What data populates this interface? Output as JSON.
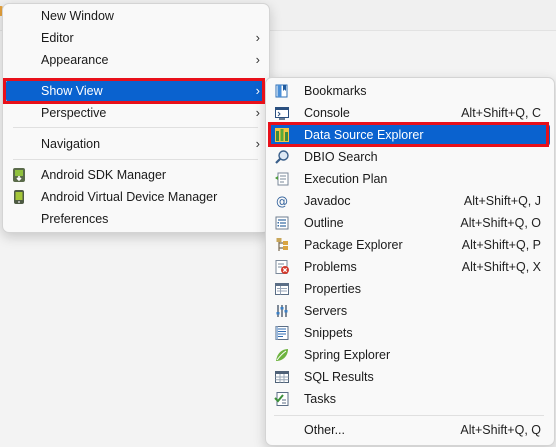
{
  "menu": {
    "items": [
      {
        "label": "New Window"
      },
      {
        "label": "Editor"
      },
      {
        "label": "Appearance"
      },
      {
        "label": "Show View"
      },
      {
        "label": "Perspective"
      },
      {
        "label": "Navigation"
      },
      {
        "label": "Android SDK Manager"
      },
      {
        "label": "Android Virtual Device Manager"
      },
      {
        "label": "Preferences"
      }
    ]
  },
  "submenu": {
    "items": [
      {
        "label": "Bookmarks",
        "shortcut": ""
      },
      {
        "label": "Console",
        "shortcut": "Alt+Shift+Q, C"
      },
      {
        "label": "Data Source Explorer",
        "shortcut": ""
      },
      {
        "label": "DBIO Search",
        "shortcut": ""
      },
      {
        "label": "Execution Plan",
        "shortcut": ""
      },
      {
        "label": "Javadoc",
        "shortcut": "Alt+Shift+Q, J"
      },
      {
        "label": "Outline",
        "shortcut": "Alt+Shift+Q, O"
      },
      {
        "label": "Package Explorer",
        "shortcut": "Alt+Shift+Q, P"
      },
      {
        "label": "Problems",
        "shortcut": "Alt+Shift+Q, X"
      },
      {
        "label": "Properties",
        "shortcut": ""
      },
      {
        "label": "Servers",
        "shortcut": ""
      },
      {
        "label": "Snippets",
        "shortcut": ""
      },
      {
        "label": "Spring Explorer",
        "shortcut": ""
      },
      {
        "label": "SQL Results",
        "shortcut": ""
      },
      {
        "label": "Tasks",
        "shortcut": ""
      },
      {
        "label": "Other...",
        "shortcut": "Alt+Shift+Q, Q"
      }
    ]
  },
  "colors": {
    "selection": "#0a62cf",
    "highlight_box": "#e8101a",
    "menu_bg": "#f9f9f9"
  },
  "icons": {
    "submenu_arrow": "›"
  }
}
